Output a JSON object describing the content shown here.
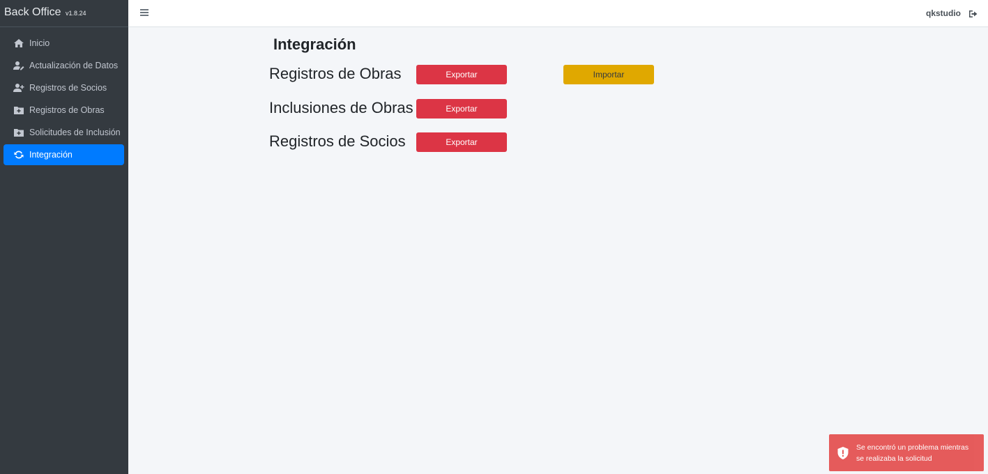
{
  "brand": {
    "title": "Back Office",
    "version": "v1.8.24"
  },
  "sidebar": {
    "items": [
      {
        "label": "Inicio",
        "icon": "home-icon",
        "active": false
      },
      {
        "label": "Actualización de Datos",
        "icon": "user-edit-icon",
        "active": false
      },
      {
        "label": "Registros de Socios",
        "icon": "user-plus-icon",
        "active": false
      },
      {
        "label": "Registros de Obras",
        "icon": "folder-plus-icon",
        "active": false
      },
      {
        "label": "Solicitudes de Inclusión",
        "icon": "folder-plus-icon",
        "active": false
      },
      {
        "label": "Integración",
        "icon": "sync-icon",
        "active": true
      }
    ]
  },
  "header": {
    "username": "qkstudio",
    "menu_icon": "hamburger-icon",
    "logout_icon": "sign-out-icon"
  },
  "main": {
    "title": "Integración",
    "rows": [
      {
        "label": "Registros de Obras",
        "export_label": "Exportar",
        "import_label": "Importar"
      },
      {
        "label": "Inclusiones de Obras",
        "export_label": "Exportar"
      },
      {
        "label": "Registros de Socios",
        "export_label": "Exportar"
      }
    ]
  },
  "toast": {
    "message": "Se encontró un problema mientras se realizaba la solicitud",
    "icon": "shield-alert-icon"
  },
  "colors": {
    "sidebar_bg": "#343a40",
    "active": "#007bff",
    "danger": "#dc3545",
    "warning": "#e0a800",
    "toast": "#e55353"
  }
}
